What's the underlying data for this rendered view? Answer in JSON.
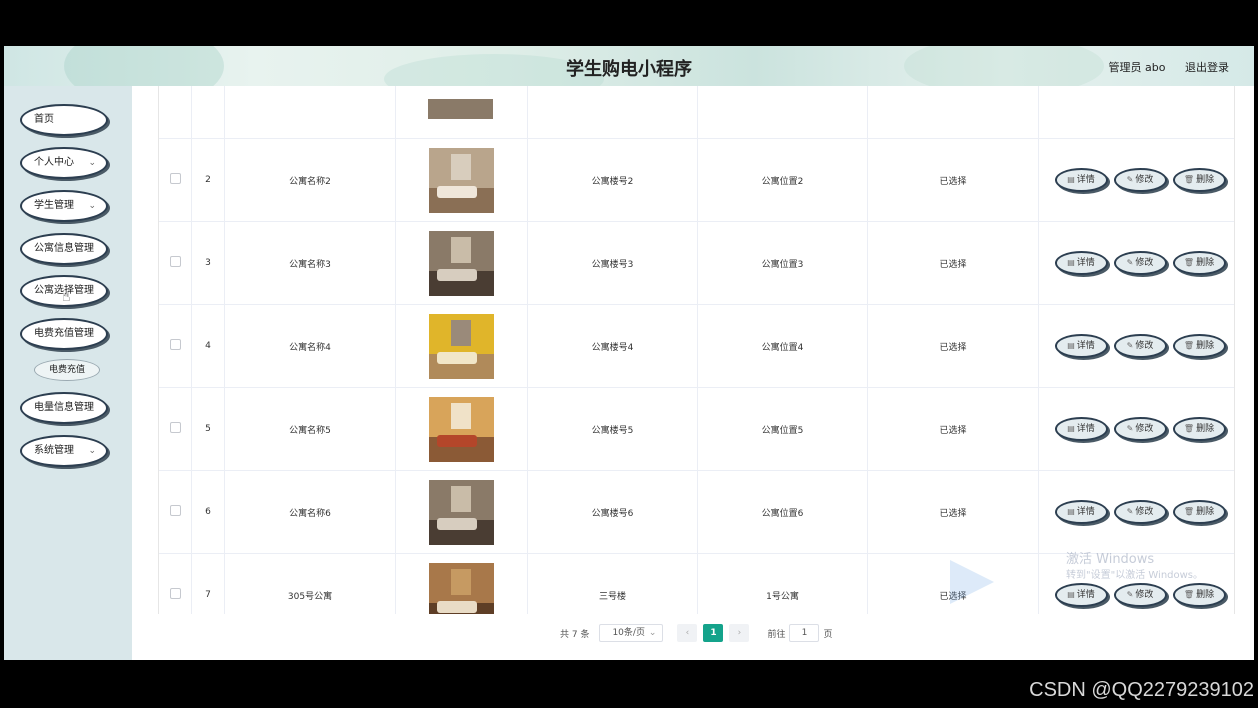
{
  "header": {
    "title": "学生购电小程序",
    "user": "管理员 abo",
    "logout": "退出登录"
  },
  "sidebar": {
    "items": [
      {
        "label": "首页",
        "has_arrow": false
      },
      {
        "label": "个人中心",
        "has_arrow": true
      },
      {
        "label": "学生管理",
        "has_arrow": true
      },
      {
        "label": "公寓信息管理",
        "has_arrow": false
      },
      {
        "label": "公寓选择管理",
        "has_arrow": false
      },
      {
        "label": "电费充值管理",
        "has_arrow": false
      },
      {
        "label": "电量信息管理",
        "has_arrow": false
      },
      {
        "label": "系统管理",
        "has_arrow": true
      }
    ],
    "sub_item": "电费充值"
  },
  "table": {
    "rows": [
      {
        "index": "2",
        "name": "公寓名称2",
        "building": "公寓楼号2",
        "location": "公寓位置2",
        "status": "已选择",
        "theme": "warm"
      },
      {
        "index": "3",
        "name": "公寓名称3",
        "building": "公寓楼号3",
        "location": "公寓位置3",
        "status": "已选择",
        "theme": "tall"
      },
      {
        "index": "4",
        "name": "公寓名称4",
        "building": "公寓楼号4",
        "location": "公寓位置4",
        "status": "已选择",
        "theme": "yellow"
      },
      {
        "index": "5",
        "name": "公寓名称5",
        "building": "公寓楼号5",
        "location": "公寓位置5",
        "status": "已选择",
        "theme": "orange"
      },
      {
        "index": "6",
        "name": "公寓名称6",
        "building": "公寓楼号6",
        "location": "公寓位置6",
        "status": "已选择",
        "theme": "tall"
      },
      {
        "index": "7",
        "name": "305号公寓",
        "building": "三号楼",
        "location": "1号公寓",
        "status": "已选择",
        "theme": "wood"
      }
    ],
    "actions": {
      "detail": "详情",
      "edit": "修改",
      "delete": "删除"
    }
  },
  "pagination": {
    "total": "共 7 条",
    "page_size": "10条/页",
    "current_page": "1",
    "goto_prefix": "前往",
    "goto_value": "1",
    "goto_suffix": "页"
  },
  "watermark": {
    "windows_line1": "激活 Windows",
    "windows_line2": "转到\"设置\"以激活 Windows。",
    "csdn": "CSDN @QQ2279239102"
  },
  "colors": {
    "accent": "#14a38b",
    "sidebar_bg": "#d9e7ea",
    "button_border": "#2c3e50"
  }
}
